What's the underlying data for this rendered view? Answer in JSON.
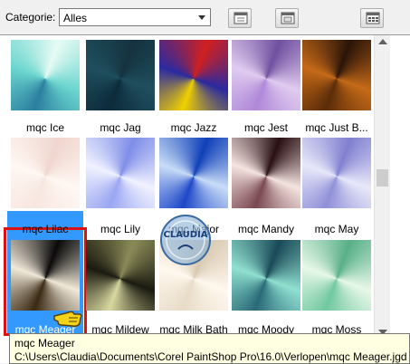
{
  "toolbar": {
    "category_label": "Categorie:",
    "category_value": "Alles"
  },
  "icons": [
    "folder-view-icon",
    "open-folder-icon",
    "grid-view-icon"
  ],
  "watermark_text": "CLAUDIA",
  "items": [
    {
      "label": "mqc Ice",
      "colors": [
        "#2a7f9f",
        "#6cd6cf",
        "#e6fbf4"
      ]
    },
    {
      "label": "mqc Jag",
      "colors": [
        "#0c2a3a",
        "#1f4f5e",
        "#15323f"
      ]
    },
    {
      "label": "mqc Jazz",
      "colors": [
        "#f0d000",
        "#2a2aa0",
        "#d02020"
      ]
    },
    {
      "label": "mqc Jest",
      "colors": [
        "#b088d8",
        "#e0ccf0",
        "#7050a0"
      ]
    },
    {
      "label": "mqc Just B...",
      "colors": [
        "#5a2c08",
        "#c56a18",
        "#2a1408"
      ]
    },
    {
      "label": "mqc Lilac",
      "colors": [
        "#f7e6e0",
        "#fff7f2",
        "#f0d6cf"
      ]
    },
    {
      "label": "mqc Lily",
      "colors": [
        "#9aa6f2",
        "#f0f2ff",
        "#7f8ee8"
      ]
    },
    {
      "label": "mqc Major",
      "colors": [
        "#1e48c8",
        "#c8dcf8",
        "#1040b8"
      ]
    },
    {
      "label": "mqc Mandy",
      "colors": [
        "#7a4850",
        "#f4e4e0",
        "#2a1014"
      ]
    },
    {
      "label": "mqc May",
      "colors": [
        "#9090d8",
        "#e8e8fa",
        "#8080d0"
      ]
    },
    {
      "label": "mqc Meager",
      "colors": [
        "#3a2a14",
        "#f0e8d8",
        "#0a0a0a"
      ]
    },
    {
      "label": "mqc Mildew",
      "colors": [
        "#d8d8a0",
        "#1a1a10",
        "#8a8a58"
      ]
    },
    {
      "label": "mqc Milk Bath",
      "colors": [
        "#e8dcc8",
        "#fff8ee",
        "#d8c8b0"
      ]
    },
    {
      "label": "mqc Moody",
      "colors": [
        "#2a6a78",
        "#90e0d0",
        "#1a4a58"
      ]
    },
    {
      "label": "mqc Moss",
      "colors": [
        "#70c8a0",
        "#e8f8e8",
        "#58b088"
      ]
    }
  ],
  "tooltip": {
    "title": "mqc Meager",
    "path": "C:\\Users\\Claudia\\Documents\\Corel PaintShop Pro\\16.0\\Verlopen\\mqc Meager.jgd"
  }
}
